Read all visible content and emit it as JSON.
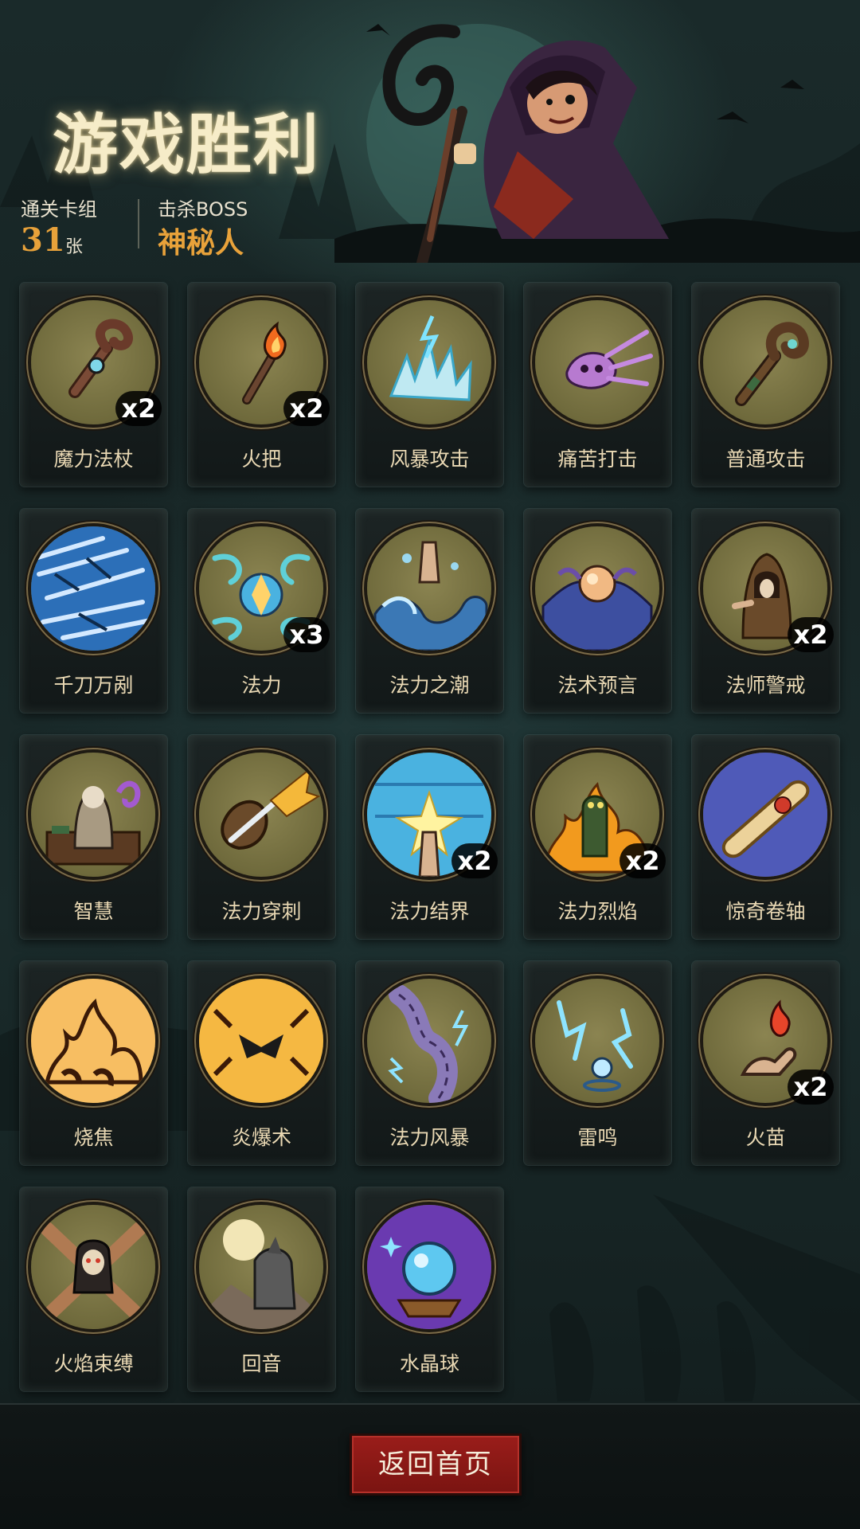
{
  "header": {
    "title": "游戏胜利",
    "deck_label": "通关卡组",
    "deck_count": "31",
    "deck_unit": "张",
    "boss_label": "击杀BOSS",
    "boss_name": "神秘人"
  },
  "cards": [
    {
      "name": "魔力法杖",
      "count": "x2",
      "icon": "magic-staff"
    },
    {
      "name": "火把",
      "count": "x2",
      "icon": "torch"
    },
    {
      "name": "风暴攻击",
      "count": "",
      "icon": "storm-attack"
    },
    {
      "name": "痛苦打击",
      "count": "",
      "icon": "pain-strike"
    },
    {
      "name": "普通攻击",
      "count": "",
      "icon": "normal-attack"
    },
    {
      "name": "千刀万剐",
      "count": "",
      "icon": "thousand-blades"
    },
    {
      "name": "法力",
      "count": "x3",
      "icon": "mana"
    },
    {
      "name": "法力之潮",
      "count": "",
      "icon": "mana-tide"
    },
    {
      "name": "法术预言",
      "count": "",
      "icon": "spell-prophecy"
    },
    {
      "name": "法师警戒",
      "count": "x2",
      "icon": "mage-vigilance"
    },
    {
      "name": "智慧",
      "count": "",
      "icon": "wisdom"
    },
    {
      "name": "法力穿刺",
      "count": "",
      "icon": "mana-pierce"
    },
    {
      "name": "法力结界",
      "count": "x2",
      "icon": "mana-barrier"
    },
    {
      "name": "法力烈焰",
      "count": "x2",
      "icon": "mana-flame"
    },
    {
      "name": "惊奇卷轴",
      "count": "",
      "icon": "wonder-scroll"
    },
    {
      "name": "烧焦",
      "count": "",
      "icon": "scorch"
    },
    {
      "name": "炎爆术",
      "count": "",
      "icon": "pyroblast"
    },
    {
      "name": "法力风暴",
      "count": "",
      "icon": "mana-storm"
    },
    {
      "name": "雷鸣",
      "count": "",
      "icon": "thunder"
    },
    {
      "name": "火苗",
      "count": "x2",
      "icon": "flame-sprout"
    },
    {
      "name": "火焰束缚",
      "count": "",
      "icon": "flame-bind"
    },
    {
      "name": "回音",
      "count": "",
      "icon": "echo"
    },
    {
      "name": "水晶球",
      "count": "",
      "icon": "crystal-ball"
    }
  ],
  "footer": {
    "home_button_label": "返回首页"
  },
  "colors": {
    "accent_gold": "#e8a23a",
    "button_red": "#8a1a17",
    "medallion": "#7e7846"
  }
}
